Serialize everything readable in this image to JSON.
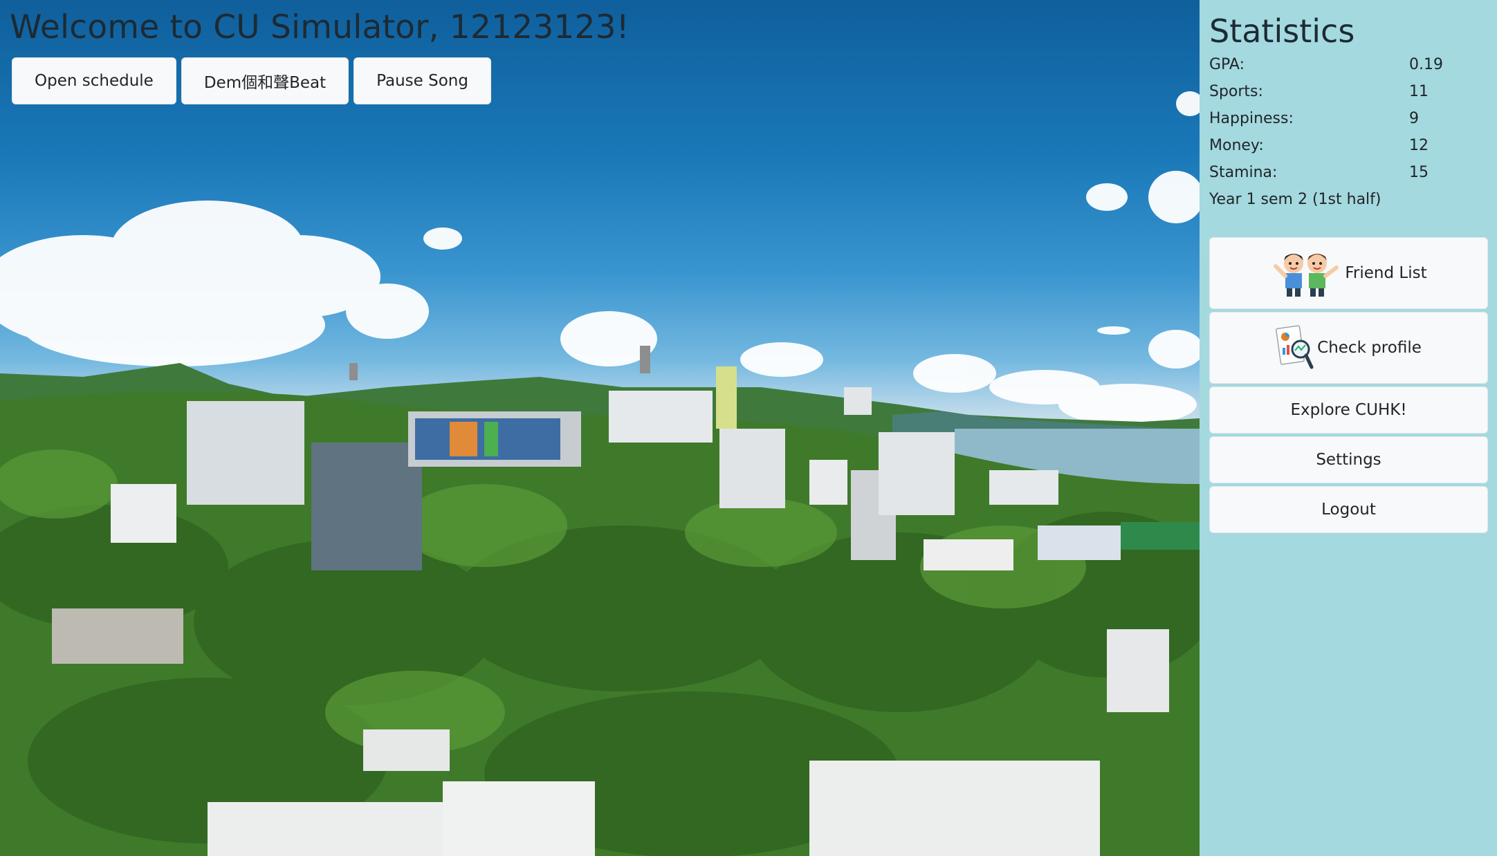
{
  "header": {
    "welcome": "Welcome to CU Simulator, 12123123!"
  },
  "toolbar": {
    "open_schedule": "Open schedule",
    "song": "Dem個和聲Beat",
    "pause_song": "Pause Song"
  },
  "sidebar": {
    "title": "Statistics",
    "stats": [
      {
        "label": "GPA:",
        "value": "0.19"
      },
      {
        "label": "Sports:",
        "value": "11"
      },
      {
        "label": "Happiness:",
        "value": "9"
      },
      {
        "label": "Money:",
        "value": "12"
      },
      {
        "label": "Stamina:",
        "value": "15"
      }
    ],
    "semester": "Year 1 sem 2 (1st half)",
    "buttons": {
      "friend_list": "Friend List",
      "check_profile": "Check profile",
      "explore": "Explore CUHK!",
      "settings": "Settings",
      "logout": "Logout"
    }
  },
  "background": {
    "image": "CUHK campus aerial panorama",
    "sky_color": "#1a78b8",
    "foliage_color": "#3f7a2a",
    "sea_color": "#8fb9c8"
  },
  "colors": {
    "sidebar_bg": "#a3d9df",
    "button_bg": "#f8f9fa",
    "text": "#212529"
  },
  "icons": {
    "friend_list": "friends-icon",
    "check_profile": "profile-chart-icon"
  }
}
